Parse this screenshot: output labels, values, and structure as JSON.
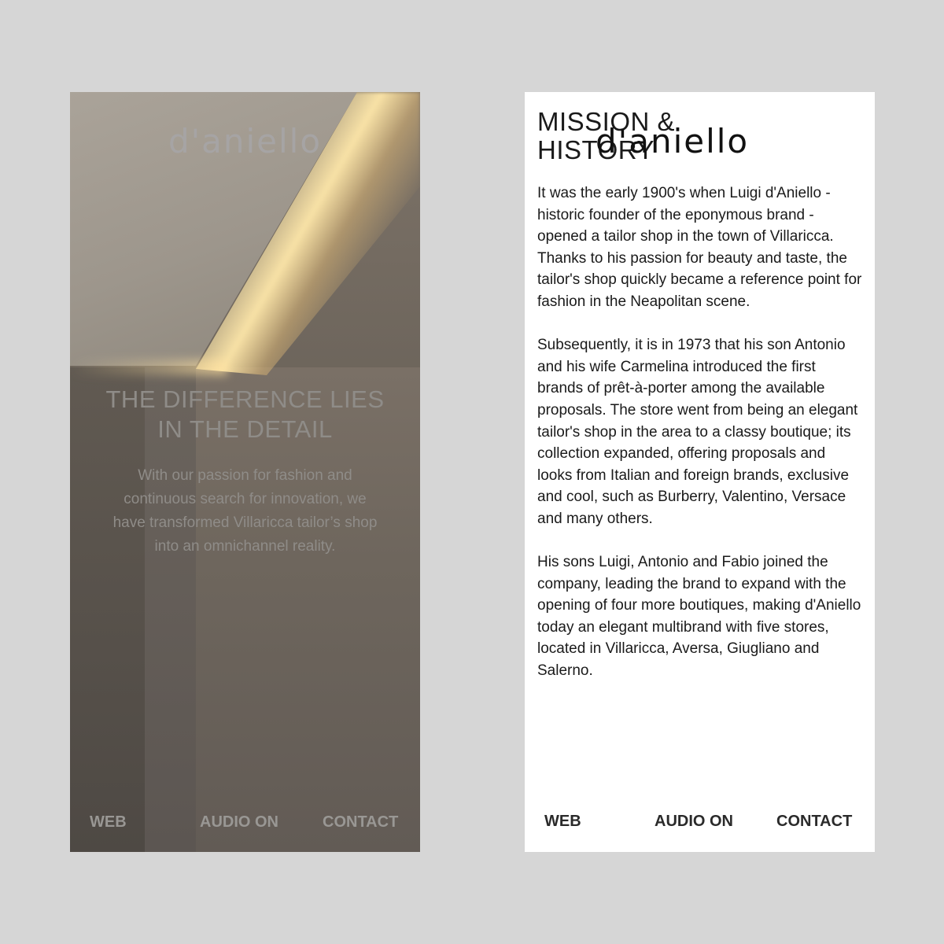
{
  "left_screen": {
    "logo": "d'aniello",
    "headline_line1": "THE DIFFERENCE LIES",
    "headline_line2": "IN THE DETAIL",
    "intro_line1": "With our passion for fashion and",
    "intro_line2": "continuous search for innovation, we",
    "intro_line3": "have transformed Villaricca tailor’s shop",
    "intro_line4": "into an omnichannel reality.",
    "nav": {
      "web": "WEB",
      "audio": "AUDIO ON",
      "contact": "CONTACT"
    }
  },
  "right_screen": {
    "title_line1": "MISSION &",
    "title_line2": "HISTORY",
    "logo": "d'aniello",
    "paragraphs": [
      "It was the early 1900's when Luigi d'Aniello - historic founder of the eponymous brand - opened a tailor shop in the town of Villaricca. Thanks to his passion for beauty and taste, the tailor's shop quickly became a reference point for fashion in the Neapolitan scene.",
      "Subsequently, it is in 1973 that his son Antonio and his wife Carmelina introduced the first brands of prêt-à-porter among the available proposals. The store went from being an elegant tailor's shop in the area to a classy boutique; its collection expanded, offering proposals and looks from Italian and foreign brands, exclusive and cool, such as Burberry, Valentino, Versace and many others.",
      "His sons Luigi, Antonio and Fabio joined the company, leading the brand to expand with the opening of four more boutiques, making d'Aniello today an elegant multibrand with five stores, located in Villaricca, Aversa, Giugliano and Salerno."
    ],
    "nav": {
      "web": "WEB",
      "audio": "AUDIO ON",
      "contact": "CONTACT"
    }
  }
}
